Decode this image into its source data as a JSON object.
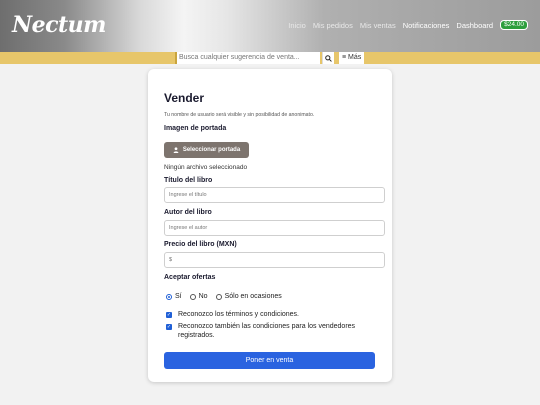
{
  "header": {
    "logo": "Nectum",
    "nav": [
      "Inicio",
      "Mis pedidos",
      "Mis ventas",
      "Notificaciones",
      "Dashboard"
    ],
    "balance": "$24.00"
  },
  "search": {
    "placeholder": "Busca cualquier sugerencia de venta...",
    "more_label": "≡ Más"
  },
  "form": {
    "title": "Vender",
    "subtitle": "Tu nombre de usuario será visible y sin posibilidad de anonimato.",
    "cover_label": "Imagen de portada",
    "cover_button": "Seleccionar portada",
    "cover_status": "Ningún archivo seleccionado",
    "title_label": "Título del libro",
    "title_placeholder": "Ingrese el título",
    "author_label": "Autor del libro",
    "author_placeholder": "Ingrese el autor",
    "price_label": "Precio del libro (MXN)",
    "price_placeholder": "$",
    "offers_label": "Aceptar ofertas",
    "offers_options": [
      "Sí",
      "No",
      "Sólo en ocasiones"
    ],
    "offers_selected": "Sí",
    "terms_1": "Reconozco los términos y condiciones.",
    "terms_2": "Reconozco también las condiciones para los vendedores registrados.",
    "submit": "Poner en venta"
  },
  "colors": {
    "accent": "#2a63e0",
    "searchbar": "#e7c66a",
    "cover_button": "#7d746e",
    "badge": "#2e9e3e"
  }
}
